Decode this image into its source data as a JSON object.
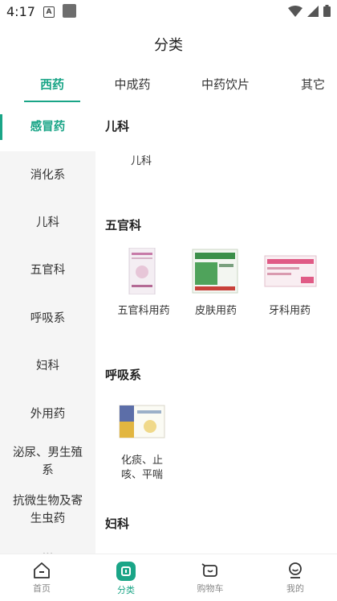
{
  "status": {
    "time": "4:17",
    "a_badge": "A"
  },
  "header": {
    "title": "分类"
  },
  "tabs": [
    {
      "label": "西药"
    },
    {
      "label": "中成药"
    },
    {
      "label": "中药饮片"
    },
    {
      "label": "其它"
    }
  ],
  "sidebar": {
    "items": [
      {
        "label": "感冒药"
      },
      {
        "label": "消化系"
      },
      {
        "label": "儿科"
      },
      {
        "label": "五官科"
      },
      {
        "label": "呼吸系"
      },
      {
        "label": "妇科"
      },
      {
        "label": "外用药"
      },
      {
        "label": "泌尿、男生殖系"
      },
      {
        "label": "抗微生物及寄生虫药"
      }
    ]
  },
  "sections": [
    {
      "title": "儿科",
      "items": [
        {
          "label": "儿科"
        }
      ]
    },
    {
      "title": "五官科",
      "items": [
        {
          "label": "五官科用药"
        },
        {
          "label": "皮肤用药"
        },
        {
          "label": "牙科用药"
        }
      ]
    },
    {
      "title": "呼吸系",
      "items": [
        {
          "label": "化痰、止咳、平喘"
        }
      ]
    },
    {
      "title": "妇科",
      "items": []
    }
  ],
  "bottom_nav": [
    {
      "label": "首页",
      "icon": "home-icon"
    },
    {
      "label": "分类",
      "icon": "category-icon"
    },
    {
      "label": "购物车",
      "icon": "cart-icon"
    },
    {
      "label": "我的",
      "icon": "profile-icon"
    }
  ],
  "colors": {
    "accent": "#1aa587",
    "sidebar_bg": "#f5f5f5"
  }
}
